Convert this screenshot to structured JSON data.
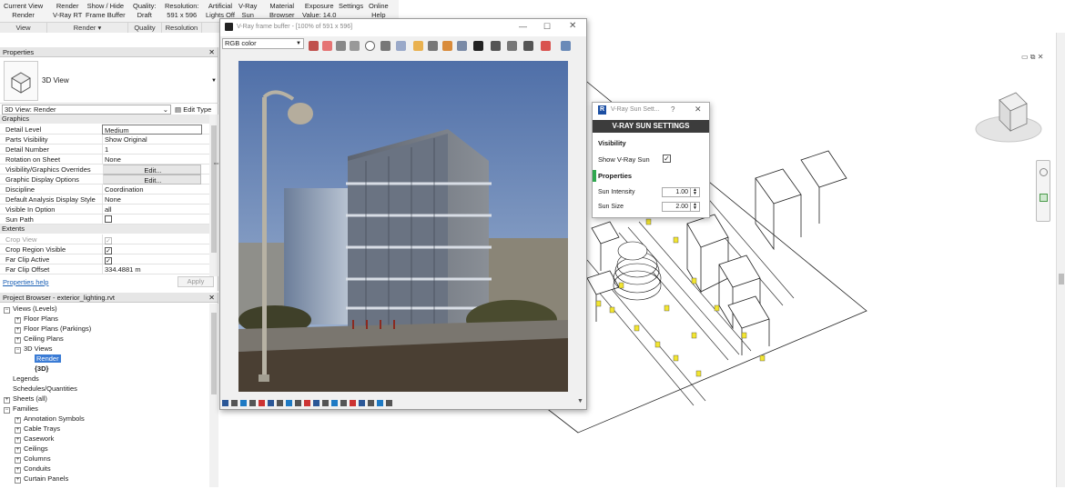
{
  "ribbon": {
    "buttons": [
      {
        "l1": "Current View",
        "l2": "Render"
      },
      {
        "l1": "Render",
        "l2": "V-Ray RT"
      },
      {
        "l1": "Show / Hide",
        "l2": "Frame Buffer"
      },
      {
        "l1": "Quality:",
        "l2": "Draft"
      },
      {
        "l1": "Resolution:",
        "l2": "591 x 596"
      },
      {
        "l1": "Artificial",
        "l2": "Lights Off"
      },
      {
        "l1": "V-Ray",
        "l2": "Sun"
      },
      {
        "l1": "Material",
        "l2": "Browser"
      },
      {
        "l1": "Exposure",
        "l2": "Value: 14.0"
      },
      {
        "l1": "Settings",
        "l2": ""
      },
      {
        "l1": "Online",
        "l2": "Help"
      }
    ],
    "groups": [
      "View",
      "Render ▾",
      "Quality",
      "Resolution"
    ]
  },
  "properties": {
    "title": "Properties",
    "type_name": "3D View",
    "selector": "3D View: Render",
    "edit_type": "Edit Type",
    "sections": {
      "graphics": "Graphics",
      "extents": "Extents"
    },
    "rows": [
      {
        "k": "Detail Level",
        "v": "Medium"
      },
      {
        "k": "Parts Visibility",
        "v": "Show Original"
      },
      {
        "k": "Detail Number",
        "v": "1"
      },
      {
        "k": "Rotation on Sheet",
        "v": "None"
      },
      {
        "k": "Visibility/Graphics Overrides",
        "v": "Edit..."
      },
      {
        "k": "Graphic Display Options",
        "v": "Edit..."
      },
      {
        "k": "Discipline",
        "v": "Coordination"
      },
      {
        "k": "Default Analysis Display Style",
        "v": "None"
      },
      {
        "k": "Visible In Option",
        "v": "all"
      },
      {
        "k": "Sun Path",
        "v": ""
      }
    ],
    "extents_rows": [
      {
        "k": "Crop View",
        "v": ""
      },
      {
        "k": "Crop Region Visible",
        "v": ""
      },
      {
        "k": "Far Clip Active",
        "v": ""
      },
      {
        "k": "Far Clip Offset",
        "v": "334.4881 m"
      }
    ],
    "help": "Properties help",
    "apply": "Apply"
  },
  "browser": {
    "title": "Project Browser - exterior_lighting.rvt",
    "items": [
      "Views (Levels)",
      "Floor Plans",
      "Floor Plans (Parkings)",
      "Ceiling Plans",
      "3D Views",
      "Render",
      "{3D}",
      "Legends",
      "Schedules/Quantities",
      "Sheets (all)",
      "Families",
      "Annotation Symbols",
      "Cable Trays",
      "Casework",
      "Ceilings",
      "Columns",
      "Conduits",
      "Curtain Panels"
    ]
  },
  "vfb": {
    "title": "V-Ray frame buffer - [100% of 591 x 596]",
    "channel": "RGB color"
  },
  "sun": {
    "title": "V-Ray Sun Sett...",
    "help": "?",
    "header": "V-RAY SUN SETTINGS",
    "visibility": "Visibility",
    "show_sun": "Show V-Ray Sun",
    "properties": "Properties",
    "intensity_label": "Sun Intensity",
    "intensity": "1.00",
    "size_label": "Sun Size",
    "size": "2.00"
  },
  "colors": {
    "ribbon": "#f3f3f3",
    "selection": "#3a7bd5",
    "sun_header": "#3c3c3c",
    "accent_green": "#2fa84f"
  }
}
